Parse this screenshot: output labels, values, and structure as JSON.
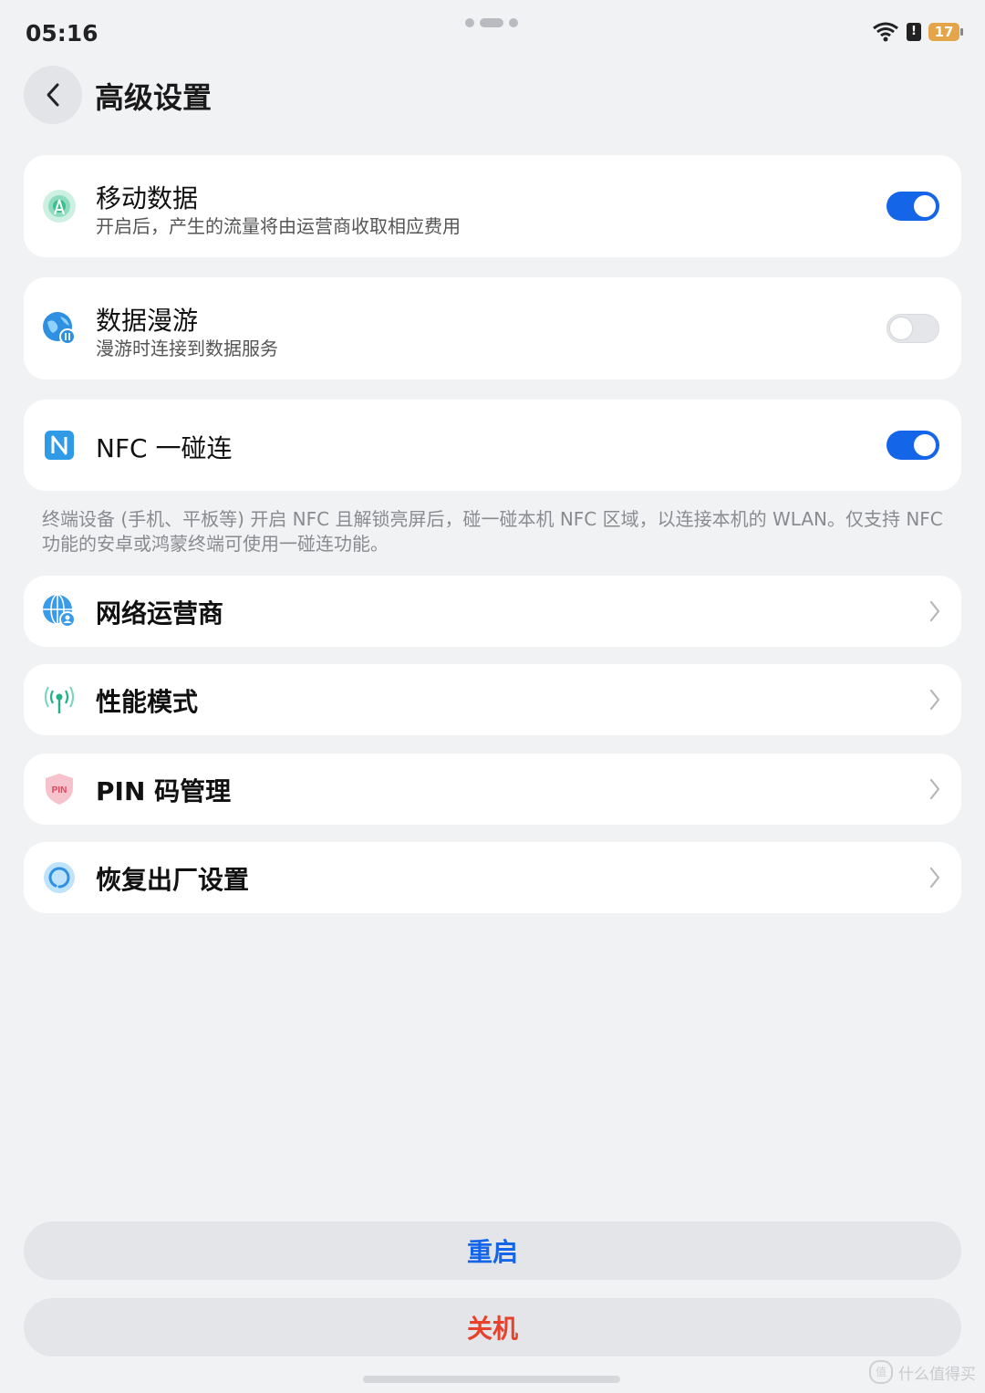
{
  "status_bar": {
    "time": "05:16",
    "battery": "17",
    "sim_label": "!"
  },
  "header": {
    "title": "高级设置"
  },
  "settings": [
    {
      "title": "移动数据",
      "subtitle": "开启后，产生的流量将由运营商收取相应费用",
      "toggle": "on"
    },
    {
      "title": "数据漫游",
      "subtitle": "漫游时连接到数据服务",
      "toggle": "off"
    },
    {
      "title": "NFC 一碰连",
      "toggle": "on"
    }
  ],
  "nfc_note": "终端设备 (手机、平板等) 开启 NFC 且解锁亮屏后，碰一碰本机 NFC 区域，以连接本机的 WLAN。仅支持 NFC 功能的安卓或鸿蒙终端可使用一碰连功能。",
  "menu": [
    {
      "label": "网络运营商",
      "icon": "globe-user-icon"
    },
    {
      "label": "性能模式",
      "icon": "antenna-icon"
    },
    {
      "label": "PIN 码管理",
      "icon": "pin-shield-icon",
      "icon_text": "PIN"
    },
    {
      "label": "恢复出厂设置",
      "icon": "reset-circle-icon"
    }
  ],
  "actions": {
    "restart": "重启",
    "shutdown": "关机"
  },
  "watermark": {
    "logo": "值",
    "text": "什么值得买"
  },
  "colors": {
    "accent": "#1565e8",
    "danger": "#e8412c",
    "background": "#f1f2f4"
  }
}
